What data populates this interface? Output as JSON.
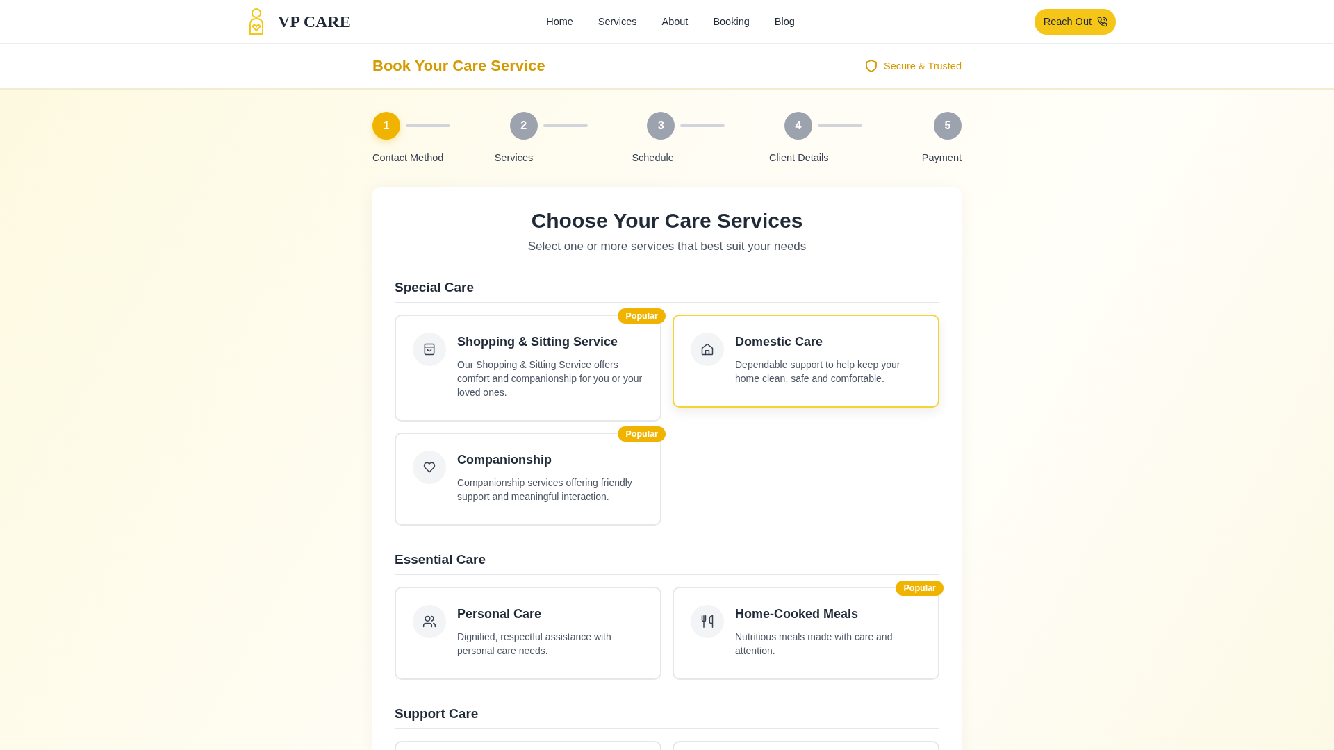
{
  "brand": "VP CARE",
  "nav": [
    {
      "label": "Home"
    },
    {
      "label": "Services"
    },
    {
      "label": "About"
    },
    {
      "label": "Booking"
    },
    {
      "label": "Blog"
    }
  ],
  "cta": "Reach Out",
  "page_title": "Book Your Care Service",
  "trust_badge": "Secure & Trusted",
  "steps": [
    {
      "number": "1",
      "label": "Contact Method",
      "selected": true
    },
    {
      "number": "2",
      "label": "Services",
      "selected": false
    },
    {
      "number": "3",
      "label": "Schedule",
      "selected": false
    },
    {
      "number": "4",
      "label": "Client Details",
      "selected": false
    },
    {
      "number": "5",
      "label": "Payment",
      "selected": false
    }
  ],
  "heading": "Choose Your Care Services",
  "subheading": "Select one or more services that best suit your needs",
  "sections": [
    {
      "title": "Special Care",
      "services": [
        {
          "kind": "shopping",
          "title": "Shopping & Sitting Service",
          "description": "Our Shopping & Sitting Service offers comfort and companionship for you or your loved ones.",
          "badge": "Popular",
          "selected": false
        },
        {
          "kind": "domestic",
          "title": "Domestic Care",
          "description": "Dependable support to help keep your home clean, safe and comfortable.",
          "selected": true
        },
        {
          "kind": "companionship",
          "title": "Companionship",
          "description": "Companionship services offering friendly support and meaningful interaction.",
          "badge": "Popular",
          "selected": false
        }
      ]
    },
    {
      "title": "Essential Care",
      "services": [
        {
          "kind": "personal",
          "title": "Personal Care",
          "description": "Dignified, respectful assistance with personal care needs.",
          "selected": false
        },
        {
          "kind": "meals",
          "title": "Home-Cooked Meals",
          "description": "Nutritious meals made with care and attention.",
          "badge": "Popular",
          "selected": false
        }
      ]
    },
    {
      "title": "Support Care",
      "services": [
        {
          "kind": "hidden",
          "selected": false
        },
        {
          "kind": "hidden",
          "selected": false
        }
      ]
    }
  ]
}
